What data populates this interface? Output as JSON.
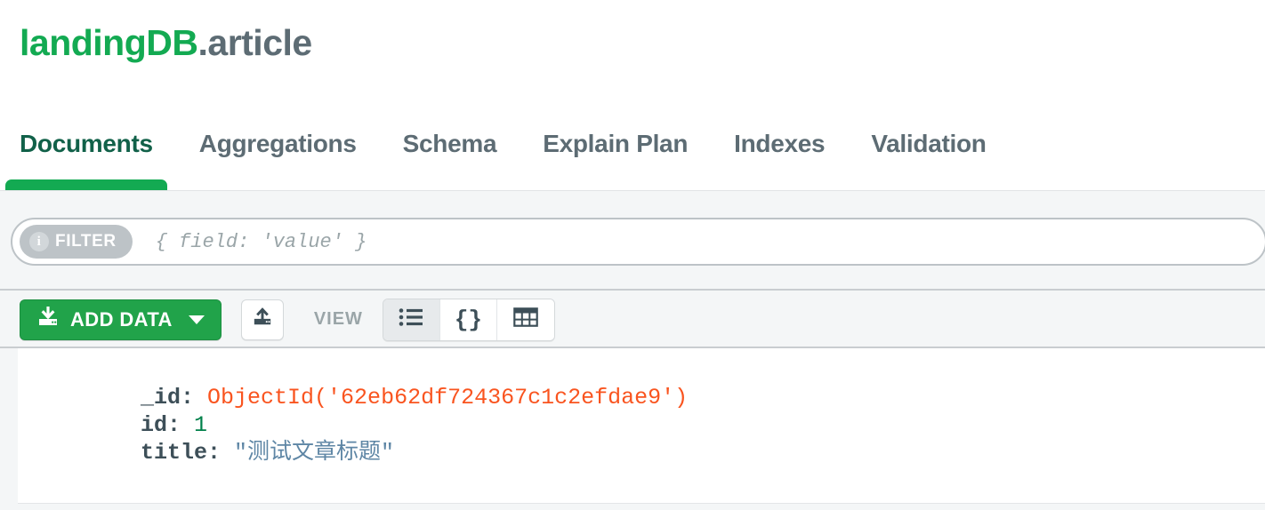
{
  "namespace": {
    "database": "landingDB",
    "separator": ".",
    "collection": "article"
  },
  "tabs": [
    {
      "label": "Documents",
      "active": true
    },
    {
      "label": "Aggregations",
      "active": false
    },
    {
      "label": "Schema",
      "active": false
    },
    {
      "label": "Explain Plan",
      "active": false
    },
    {
      "label": "Indexes",
      "active": false
    },
    {
      "label": "Validation",
      "active": false
    }
  ],
  "query_bar": {
    "filter_label": "FILTER",
    "info_glyph": "i",
    "filter_value": "",
    "filter_placeholder": "{ field: 'value' }"
  },
  "toolbar": {
    "add_data_label": "ADD DATA",
    "add_data_icon": "import-download-icon",
    "add_data_caret": "chevron-down-icon",
    "export_icon": "export-upload-icon",
    "view_label": "VIEW",
    "view_modes": [
      {
        "name": "list-view",
        "icon": "list-icon",
        "glyph": "",
        "active": true
      },
      {
        "name": "json-view",
        "icon": "braces-icon",
        "glyph": "{}",
        "active": false
      },
      {
        "name": "table-view",
        "icon": "table-icon",
        "glyph": "",
        "active": false
      }
    ]
  },
  "document": {
    "fields": [
      {
        "key": "_id",
        "value": "ObjectId('62eb62df724367c1c2efdae9')",
        "type": "objectid"
      },
      {
        "key": "id",
        "value": "1",
        "type": "number"
      },
      {
        "key": "title",
        "value": "\"测试文章标题\"",
        "type": "string"
      }
    ]
  },
  "colors": {
    "brand_green": "#13aa52",
    "active_tab_text": "#116149",
    "button_green": "#21a34a",
    "muted_text": "#5d6c74",
    "objectid_orange": "#f9541f",
    "number_green": "#00804a",
    "string_blue": "#5e86a5",
    "key_slate": "#3d4f58",
    "panel_bg": "#f4f6f7"
  }
}
